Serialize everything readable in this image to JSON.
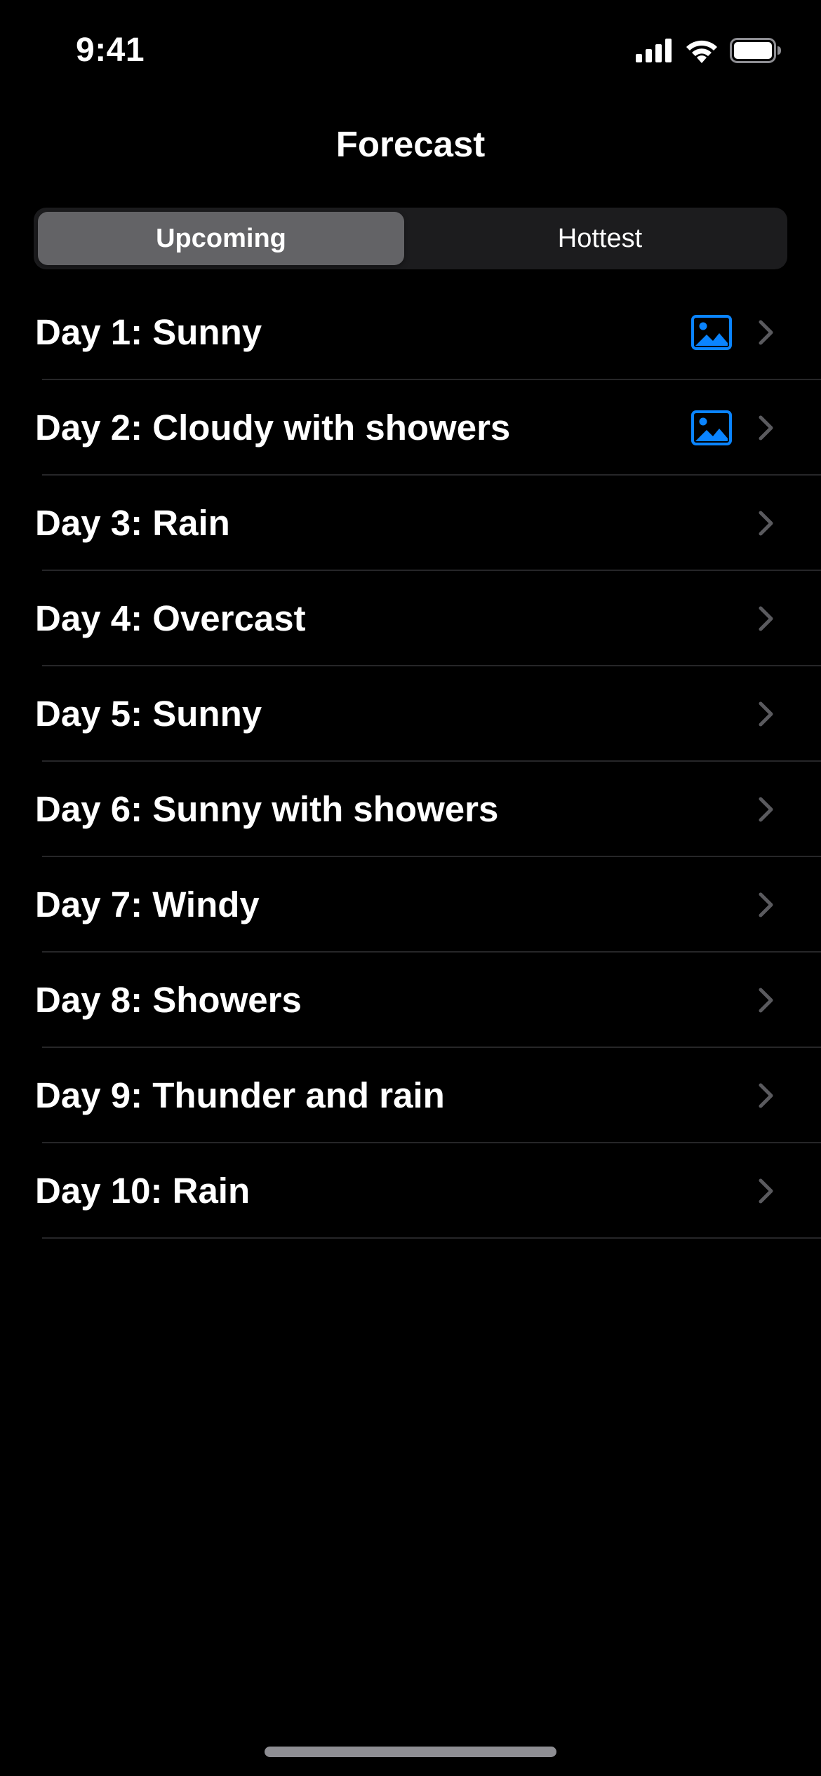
{
  "status_bar": {
    "time": "9:41",
    "icons": [
      "cellular-signal-icon",
      "wifi-icon",
      "battery-icon"
    ]
  },
  "nav": {
    "title": "Forecast"
  },
  "segmented_control": {
    "segments": [
      {
        "label": "Upcoming",
        "selected": true
      },
      {
        "label": "Hottest",
        "selected": false
      }
    ]
  },
  "forecast": {
    "rows": [
      {
        "label": "Day 1: Sunny",
        "has_photo": true
      },
      {
        "label": "Day 2: Cloudy with showers",
        "has_photo": true
      },
      {
        "label": "Day 3: Rain",
        "has_photo": false
      },
      {
        "label": "Day 4: Overcast",
        "has_photo": false
      },
      {
        "label": "Day 5: Sunny",
        "has_photo": false
      },
      {
        "label": "Day 6: Sunny with showers",
        "has_photo": false
      },
      {
        "label": "Day 7: Windy",
        "has_photo": false
      },
      {
        "label": "Day 8: Showers",
        "has_photo": false
      },
      {
        "label": "Day 9: Thunder and rain",
        "has_photo": false
      },
      {
        "label": "Day 10: Rain",
        "has_photo": false
      }
    ]
  },
  "colors": {
    "background": "#000000",
    "text": "#ffffff",
    "accent": "#0a84ff",
    "chevron": "#5a5a5e",
    "separator": "#262628",
    "segment_track": "#1c1c1e",
    "segment_selected": "#636366"
  }
}
